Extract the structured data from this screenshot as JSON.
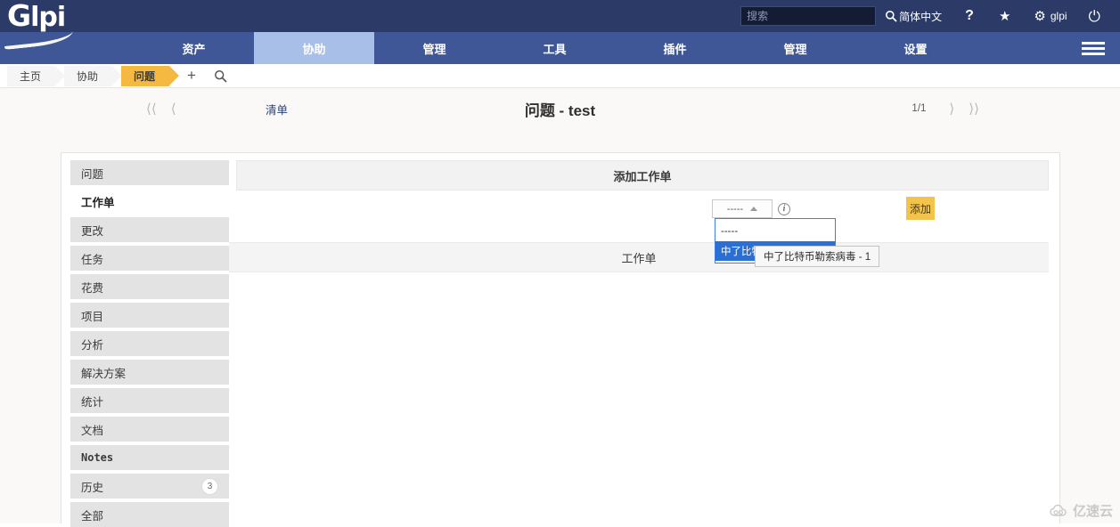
{
  "header": {
    "logo_text": "lpi",
    "logo_mark": "G",
    "search_placeholder": "搜索",
    "search_value": "",
    "language": "简体中文",
    "help": "?",
    "star": "★",
    "user": "glpi",
    "icons": {
      "search": "search-icon",
      "gear": "gear-icon",
      "power": "power-icon",
      "star": "star-icon"
    }
  },
  "nav": {
    "items": [
      {
        "label": "资产",
        "active": false
      },
      {
        "label": "协助",
        "active": true
      },
      {
        "label": "管理",
        "active": false
      },
      {
        "label": "工具",
        "active": false
      },
      {
        "label": "插件",
        "active": false
      },
      {
        "label": "管理",
        "active": false
      },
      {
        "label": "设置",
        "active": false
      }
    ]
  },
  "breadcrumb": {
    "items": [
      {
        "label": "主页",
        "active": false
      },
      {
        "label": "协助",
        "active": false
      },
      {
        "label": "问题",
        "active": true
      }
    ],
    "add_label": "+",
    "search_label": "⌕"
  },
  "titlebar": {
    "first_arrow": "⟨⟨",
    "prev_arrow": "⟨",
    "list_link": "清单",
    "title": "问题 - test",
    "page_count": "1/1",
    "next_arrow": "⟩",
    "last_arrow": "⟩⟩"
  },
  "sidebar": {
    "items": [
      {
        "label": "问题",
        "active": false,
        "badge": ""
      },
      {
        "label": "工作单",
        "active": true,
        "badge": ""
      },
      {
        "label": "更改",
        "active": false,
        "badge": ""
      },
      {
        "label": "任务",
        "active": false,
        "badge": ""
      },
      {
        "label": "花费",
        "active": false,
        "badge": ""
      },
      {
        "label": "项目",
        "active": false,
        "badge": ""
      },
      {
        "label": "分析",
        "active": false,
        "badge": ""
      },
      {
        "label": "解决方案",
        "active": false,
        "badge": ""
      },
      {
        "label": "统计",
        "active": false,
        "badge": ""
      },
      {
        "label": "文档",
        "active": false,
        "badge": ""
      },
      {
        "label": "Notes",
        "active": false,
        "badge": "",
        "mono": true
      },
      {
        "label": "历史",
        "active": false,
        "badge": "3"
      },
      {
        "label": "全部",
        "active": false,
        "badge": ""
      }
    ]
  },
  "main": {
    "add_panel_title": "添加工作单",
    "select_value": "-----",
    "info_icon_label": "i",
    "add_button": "添加",
    "dropdown": {
      "open": true,
      "options": [
        {
          "label": "-----",
          "selected": false
        },
        {
          "label": "中了比特币勒索病毒 - 1",
          "selected": true
        }
      ]
    },
    "tooltip_text": "中了比特币勒索病毒 - 1",
    "list_panel_title": "工作单"
  },
  "watermark": {
    "text": "亿速云"
  },
  "colors": {
    "topbar": "#2b3a66",
    "nav": "#3f5796",
    "nav_active": "#a8c0e8",
    "crumb_active": "#f5b841",
    "add_button": "#f2c44c",
    "dropdown_selected": "#2a6fd6"
  }
}
